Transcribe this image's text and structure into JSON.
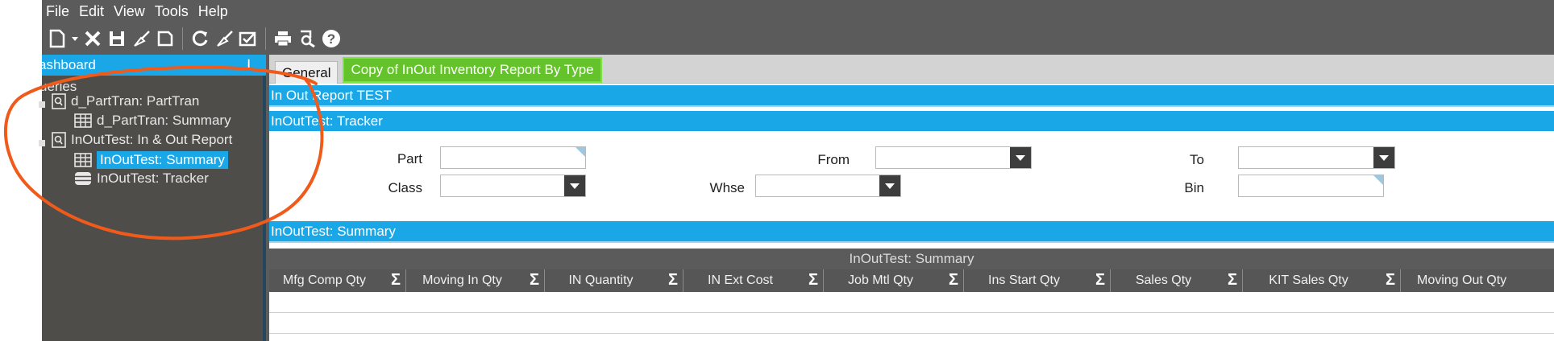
{
  "menu": [
    "File",
    "Edit",
    "View",
    "Tools",
    "Help"
  ],
  "toolbar_icons": [
    "new-icon",
    "new-dropdown-icon",
    "delete-icon",
    "save-icon",
    "clear-icon",
    "undo-icon",
    "refresh-icon",
    "clear-all-icon",
    "attach-icon",
    "print-icon",
    "print-preview-icon",
    "help-icon"
  ],
  "sidebar": {
    "title": "ashboard",
    "pin": "ᵠ",
    "section": "ueries",
    "items": [
      {
        "label": "d_PartTran: PartTran",
        "icon": "query-icon"
      },
      {
        "label": "d_PartTran: Summary",
        "icon": "grid-icon"
      },
      {
        "label": "InOutTest: In & Out Report",
        "icon": "query-icon"
      },
      {
        "label": "InOutTest: Summary",
        "icon": "grid-icon",
        "selected": true
      },
      {
        "label": "InOutTest: Tracker",
        "icon": "tracker-icon"
      }
    ]
  },
  "tabs": {
    "general": "General",
    "active": "Copy of InOut Inventory Report By Type"
  },
  "bars": {
    "report": "In  Out Report TEST",
    "tracker": "InOutTest: Tracker",
    "summary": "InOutTest: Summary"
  },
  "fields": {
    "part": "Part",
    "from": "From",
    "to": "To",
    "class": "Class",
    "whse": "Whse",
    "bin": "Bin"
  },
  "grid": {
    "title": "InOutTest: Summary",
    "sigma": "Σ",
    "columns": [
      "Mfg Comp Qty",
      "Moving In Qty",
      "IN Quantity",
      "IN Ext Cost",
      "Job Mtl Qty",
      "Ins Start Qty",
      "Sales Qty",
      "KIT Sales Qty",
      "Moving Out Qty"
    ]
  },
  "colors": {
    "accent": "#1aa7e8",
    "tab_active": "#64c32b",
    "annotation": "#f05a1a",
    "toolbar_bg": "#5b5b5b"
  }
}
